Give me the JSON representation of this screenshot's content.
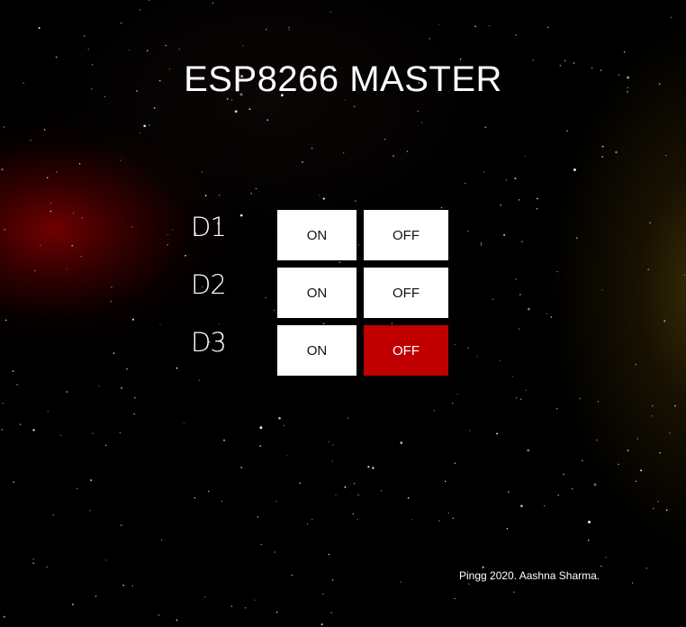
{
  "page": {
    "title": "ESP8266 MASTER",
    "footer": "Pingg 2020. Aashna Sharma."
  },
  "theme": {
    "button_bg": "#ffffff",
    "button_text": "#111111",
    "active_off_bg": "#c00000",
    "active_off_text": "#ffffff"
  },
  "devices": [
    {
      "label": "D1",
      "on_label": "ON",
      "off_label": "OFF",
      "state": "none"
    },
    {
      "label": "D2",
      "on_label": "ON",
      "off_label": "OFF",
      "state": "none"
    },
    {
      "label": "D3",
      "on_label": "ON",
      "off_label": "OFF",
      "state": "off"
    }
  ]
}
